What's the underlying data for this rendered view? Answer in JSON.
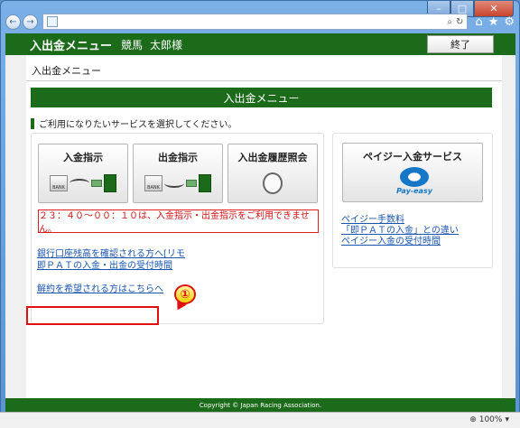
{
  "browser": {
    "nav_back": "←",
    "nav_forward": "→",
    "search_glyph": "⌕",
    "refresh_glyph": "↻",
    "home_icon": "⌂",
    "favorites_icon": "★",
    "settings_icon": "⚙",
    "minimize": "–",
    "maximize": "□",
    "close": "✕",
    "zoom": "100%",
    "zoom_arrow": "▾"
  },
  "header": {
    "title": "入出金メニュー",
    "service": "競馬",
    "user": "太郎様",
    "exit_label": "終了"
  },
  "page": {
    "breadcrumb": "入出金メニュー",
    "section_title": "入出金メニュー",
    "lead": "ご利用になりたいサービスを選択してください。",
    "tiles": {
      "deposit": "入金指示",
      "withdraw": "出金指示",
      "history": "入出金履歴照会",
      "payeasy": "ペイジー入金サービス"
    },
    "bank_text": "BANK",
    "payeasy_logo_text": "Pay-easy",
    "warning": "２３：４０～００：１０は、入金指示・出金指示をご利用できません。",
    "links_left": [
      "銀行口座残高を確認される方へ[リモ",
      "即ＰＡＴの入金・出金の受付時間",
      "解約を希望される方はこちらへ"
    ],
    "links_right": [
      "ペイジー手数料",
      "「即ＰＡＴの入金」との違い",
      "ペイジー入金の受付時間"
    ],
    "callout": "①"
  },
  "footer": "Copyright © Japan Racing Association."
}
